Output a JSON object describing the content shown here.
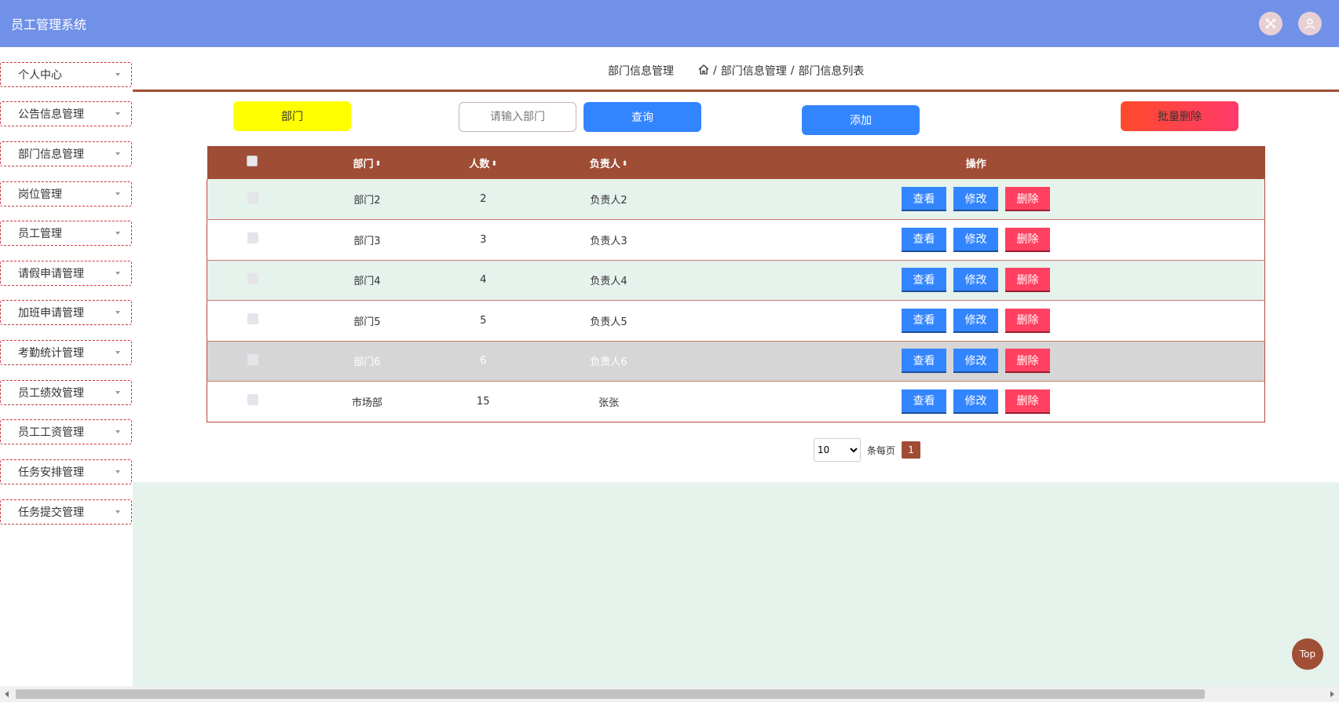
{
  "header": {
    "title": "员工管理系统",
    "fullscreen_icon": "fullscreen-icon",
    "user_icon": "user-icon"
  },
  "sidebar": {
    "items": [
      {
        "label": "个人中心"
      },
      {
        "label": "公告信息管理"
      },
      {
        "label": "部门信息管理"
      },
      {
        "label": "岗位管理"
      },
      {
        "label": "员工管理"
      },
      {
        "label": "请假申请管理"
      },
      {
        "label": "加班申请管理"
      },
      {
        "label": "考勤统计管理"
      },
      {
        "label": "员工绩效管理"
      },
      {
        "label": "员工工资管理"
      },
      {
        "label": "任务安排管理"
      },
      {
        "label": "任务提交管理"
      }
    ]
  },
  "breadcrumb": {
    "title": "部门信息管理",
    "sep": "/",
    "level1": "部门信息管理",
    "level2": "部门信息列表"
  },
  "toolbar": {
    "dept_label": "部门",
    "search_placeholder": "请输入部门",
    "query_label": "查询",
    "add_label": "添加",
    "batch_delete_label": "批量删除"
  },
  "table": {
    "headers": {
      "dept": "部门",
      "count": "人数",
      "leader": "负责人",
      "ops": "操作"
    },
    "sort_glyph": "⬍",
    "rows": [
      {
        "dept": "部门2",
        "count": "2",
        "leader": "负责人2"
      },
      {
        "dept": "部门3",
        "count": "3",
        "leader": "负责人3"
      },
      {
        "dept": "部门4",
        "count": "4",
        "leader": "负责人4"
      },
      {
        "dept": "部门5",
        "count": "5",
        "leader": "负责人5"
      },
      {
        "dept": "部门6",
        "count": "6",
        "leader": "负责人6"
      },
      {
        "dept": "市场部",
        "count": "15",
        "leader": "张张"
      }
    ],
    "actions": {
      "view": "查看",
      "edit": "修改",
      "delete": "删除"
    }
  },
  "pagination": {
    "page_size": "10",
    "per_page_label": "条每页",
    "current_page": "1"
  },
  "top_button": "Top",
  "colors": {
    "header_bg": "#7191e9",
    "accent": "#a14f35",
    "primary_button": "#3385ff",
    "danger_button": "#ff4060"
  }
}
